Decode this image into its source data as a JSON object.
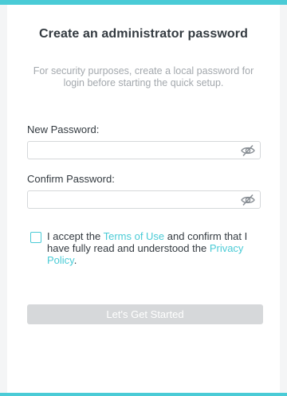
{
  "header": {
    "title": "Create an administrator password",
    "subtitle": "For security purposes, create a local password for login before starting the quick setup."
  },
  "form": {
    "new_password": {
      "label": "New Password:",
      "value": "",
      "placeholder": ""
    },
    "confirm_password": {
      "label": "Confirm Password:",
      "value": "",
      "placeholder": ""
    },
    "terms": {
      "checked": false,
      "text_before": "I accept the ",
      "terms_link": "Terms of Use",
      "text_middle": " and confirm that I have fully read and understood the ",
      "privacy_link": "Privacy Policy",
      "text_after": "."
    },
    "submit_label": "Let's Get Started"
  },
  "colors": {
    "accent": "#4acbd6",
    "button_disabled": "#d6d8da",
    "text": "#333a40",
    "muted_text": "#a3a8ad"
  },
  "icons": {
    "password_visibility": "eye-slash-icon"
  }
}
